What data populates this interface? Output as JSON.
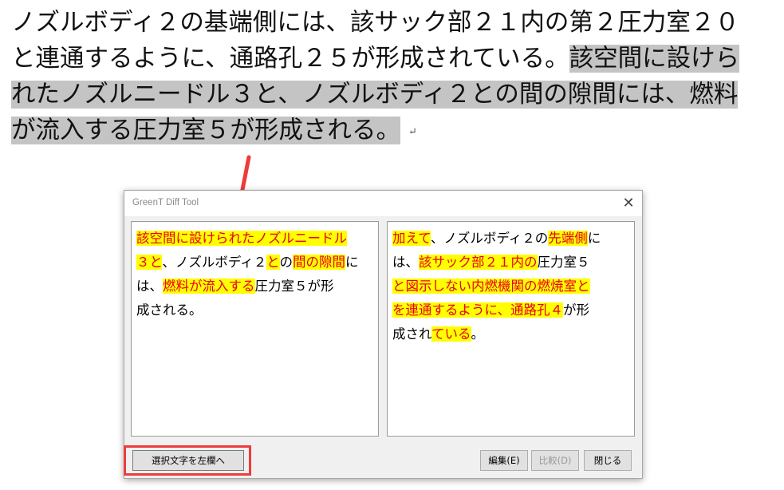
{
  "document": {
    "lines": [
      {
        "plain": "ノズルボディ２の基端側には、該サック部２１内の第２圧力室２０",
        "selected": ""
      },
      {
        "plain": "と連通するように、通路孔２５が形成されている。",
        "selected": "該空間に設けら"
      },
      {
        "plain": "",
        "selected": "れたノズルニードル３と、ノズルボディ２との間の隙間には、燃料"
      },
      {
        "plain": "",
        "selected": "が流入する圧力室５が形成される。"
      }
    ],
    "paragraph_mark": "↵"
  },
  "dialog": {
    "title": "GreenT Diff Tool",
    "close_glyph": "✕",
    "left_pane": {
      "lines": [
        [
          {
            "t": "該空間に設けられたノズルニードル",
            "h": true
          }
        ],
        [
          {
            "t": "３と",
            "h": true
          },
          {
            "t": "、ノズルボディ２",
            "h": false
          },
          {
            "t": "と",
            "h": true
          },
          {
            "t": "の",
            "h": false
          },
          {
            "t": "間の隙間",
            "h": true
          },
          {
            "t": "に",
            "h": false
          }
        ],
        [
          {
            "t": "は、",
            "h": false
          },
          {
            "t": "燃料が流入する",
            "h": true
          },
          {
            "t": "圧力室５が形",
            "h": false
          }
        ],
        [
          {
            "t": "成される。",
            "h": false
          }
        ]
      ]
    },
    "right_pane": {
      "lines": [
        [
          {
            "t": "加えて",
            "h": true
          },
          {
            "t": "、ノズルボディ２の",
            "h": false
          },
          {
            "t": "先端側",
            "h": true
          },
          {
            "t": "に",
            "h": false
          }
        ],
        [
          {
            "t": "は、",
            "h": false
          },
          {
            "t": "該サック部２１内の",
            "h": true
          },
          {
            "t": "圧力室５",
            "h": false
          }
        ],
        [
          {
            "t": "と図示しない内燃機関の燃焼室と",
            "h": true
          }
        ],
        [
          {
            "t": "を連通するように、通路孔４",
            "h": true
          },
          {
            "t": "が形",
            "h": false
          }
        ],
        [
          {
            "t": "成され",
            "h": false
          },
          {
            "t": "ている",
            "h": true
          },
          {
            "t": "。",
            "h": false
          }
        ]
      ]
    },
    "buttons": {
      "copy_to_left": "選択文字を左欄へ",
      "edit": "編集(E)",
      "compare": "比較(D)",
      "close": "閉じる"
    }
  },
  "colors": {
    "highlight_bg": "#ffff00",
    "highlight_text": "#e8001c",
    "selection_bg": "#c4c4c4",
    "annotation_red": "#ee3b3b"
  }
}
